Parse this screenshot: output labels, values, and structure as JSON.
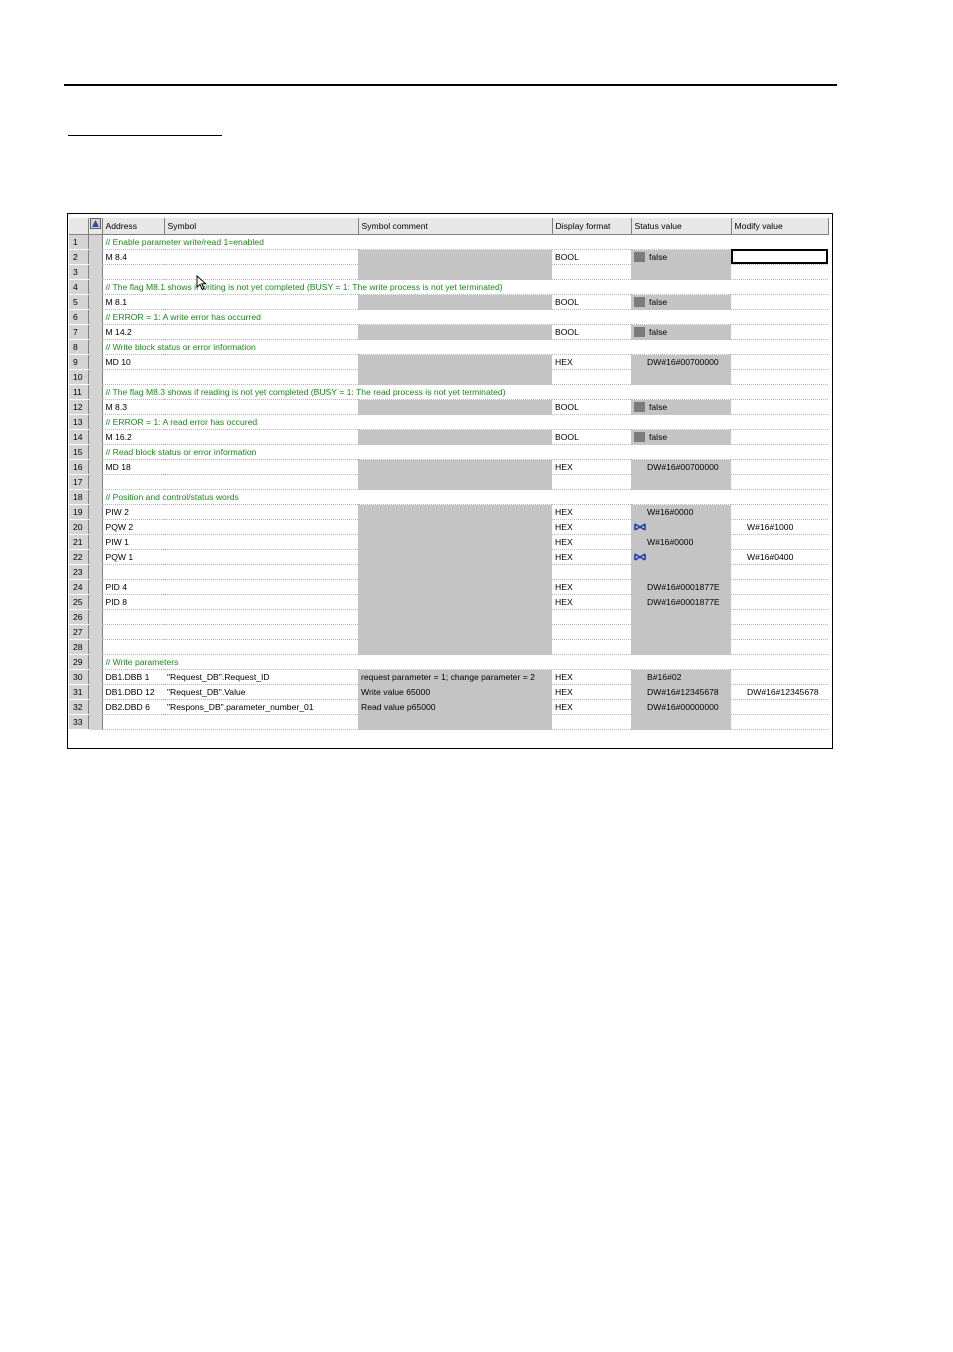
{
  "table": {
    "columns": {
      "address": "Address",
      "symbol": "Symbol",
      "symbol_comment": "Symbol comment",
      "display_format": "Display format",
      "status_value": "Status value",
      "modify_value": "Modify value"
    },
    "rows": [
      {
        "n": "1",
        "type": "comment",
        "text": "// Enable parameter write/read  1=enabled"
      },
      {
        "n": "2",
        "type": "data",
        "address": "M    8.4",
        "symbol": "",
        "comment": "",
        "format": "BOOL",
        "status": "false",
        "status_box": true,
        "modify": "",
        "shade": true,
        "selected": true
      },
      {
        "n": "3",
        "type": "empty",
        "shade": true
      },
      {
        "n": "4",
        "type": "comment",
        "text": "// The flag M8.1 shows if writing is not yet completed (BUSY = 1: The write process is not yet terminated)"
      },
      {
        "n": "5",
        "type": "data",
        "address": "M    8.1",
        "symbol": "",
        "comment": "",
        "format": "BOOL",
        "status": "false",
        "status_box": true,
        "modify": "",
        "shade": true
      },
      {
        "n": "6",
        "type": "comment",
        "text": "// ERROR = 1: A write error has occurred"
      },
      {
        "n": "7",
        "type": "data",
        "address": "M    14.2",
        "symbol": "",
        "comment": "",
        "format": "BOOL",
        "status": "false",
        "status_box": true,
        "modify": "",
        "shade": true
      },
      {
        "n": "8",
        "type": "comment",
        "text": "// Write block status or error information"
      },
      {
        "n": "9",
        "type": "data",
        "address": "MD    10",
        "symbol": "",
        "comment": "",
        "format": "HEX",
        "status": "DW#16#00700000",
        "modify": "",
        "shade": true
      },
      {
        "n": "10",
        "type": "empty",
        "shade": true
      },
      {
        "n": "11",
        "type": "comment",
        "text": "// The flag M8.3 shows if reading is not yet completed (BUSY = 1: The read process is not yet terminated)"
      },
      {
        "n": "12",
        "type": "data",
        "address": "M    8.3",
        "symbol": "",
        "comment": "",
        "format": "BOOL",
        "status": "false",
        "status_box": true,
        "modify": "",
        "shade": true
      },
      {
        "n": "13",
        "type": "comment",
        "text": "// ERROR = 1: A read error has occured"
      },
      {
        "n": "14",
        "type": "data",
        "address": "M    16.2",
        "symbol": "",
        "comment": "",
        "format": "BOOL",
        "status": "false",
        "status_box": true,
        "modify": "",
        "shade": true
      },
      {
        "n": "15",
        "type": "comment",
        "text": "// Read block status or error information"
      },
      {
        "n": "16",
        "type": "data",
        "address": "MD    18",
        "symbol": "",
        "comment": "",
        "format": "HEX",
        "status": "DW#16#00700000",
        "modify": "",
        "shade": true
      },
      {
        "n": "17",
        "type": "empty",
        "shade": true
      },
      {
        "n": "18",
        "type": "comment",
        "text": "// Position and control/status words"
      },
      {
        "n": "19",
        "type": "data",
        "address": "PIW    2",
        "symbol": "",
        "comment": "",
        "format": "HEX",
        "status": "W#16#0000",
        "modify": "",
        "shade": true
      },
      {
        "n": "20",
        "type": "data",
        "address": "PQW    2",
        "symbol": "",
        "comment": "",
        "format": "HEX",
        "status": "",
        "status_icon": true,
        "modify": "W#16#1000",
        "shade": true
      },
      {
        "n": "21",
        "type": "data",
        "address": "PIW    1",
        "symbol": "",
        "comment": "",
        "format": "HEX",
        "status": "W#16#0000",
        "modify": "",
        "shade": true
      },
      {
        "n": "22",
        "type": "data",
        "address": "PQW    1",
        "symbol": "",
        "comment": "",
        "format": "HEX",
        "status": "",
        "status_icon": true,
        "modify": "W#16#0400",
        "shade": true
      },
      {
        "n": "23",
        "type": "empty",
        "shade": true
      },
      {
        "n": "24",
        "type": "data",
        "address": "PID    4",
        "symbol": "",
        "comment": "",
        "format": "HEX",
        "status": "DW#16#0001877E",
        "modify": "",
        "shade": true
      },
      {
        "n": "25",
        "type": "data",
        "address": "PID    8",
        "symbol": "",
        "comment": "",
        "format": "HEX",
        "status": "DW#16#0001877E",
        "modify": "",
        "shade": true
      },
      {
        "n": "26",
        "type": "empty",
        "shade": true
      },
      {
        "n": "27",
        "type": "empty",
        "shade": true
      },
      {
        "n": "28",
        "type": "empty",
        "shade": true
      },
      {
        "n": "29",
        "type": "comment",
        "text": "// Write parameters"
      },
      {
        "n": "30",
        "type": "data",
        "address": "DB1.DBB    1",
        "symbol": "\"Request_DB\".Request_ID",
        "comment": "request parameter = 1; change parameter = 2",
        "format": "HEX",
        "status": "B#16#02",
        "modify": "",
        "shade": true
      },
      {
        "n": "31",
        "type": "data",
        "address": "DB1.DBD    12",
        "symbol": "\"Request_DB\".Value",
        "comment": "Write value 65000",
        "format": "HEX",
        "status": "DW#16#12345678",
        "modify": "DW#16#12345678",
        "shade": true
      },
      {
        "n": "32",
        "type": "data",
        "address": "DB2.DBD    6",
        "symbol": "\"Respons_DB\".parameter_number_01",
        "comment": "Read value p65000",
        "format": "HEX",
        "status": "DW#16#00000000",
        "modify": "",
        "shade": true
      },
      {
        "n": "33",
        "type": "empty",
        "shade": true
      }
    ]
  }
}
